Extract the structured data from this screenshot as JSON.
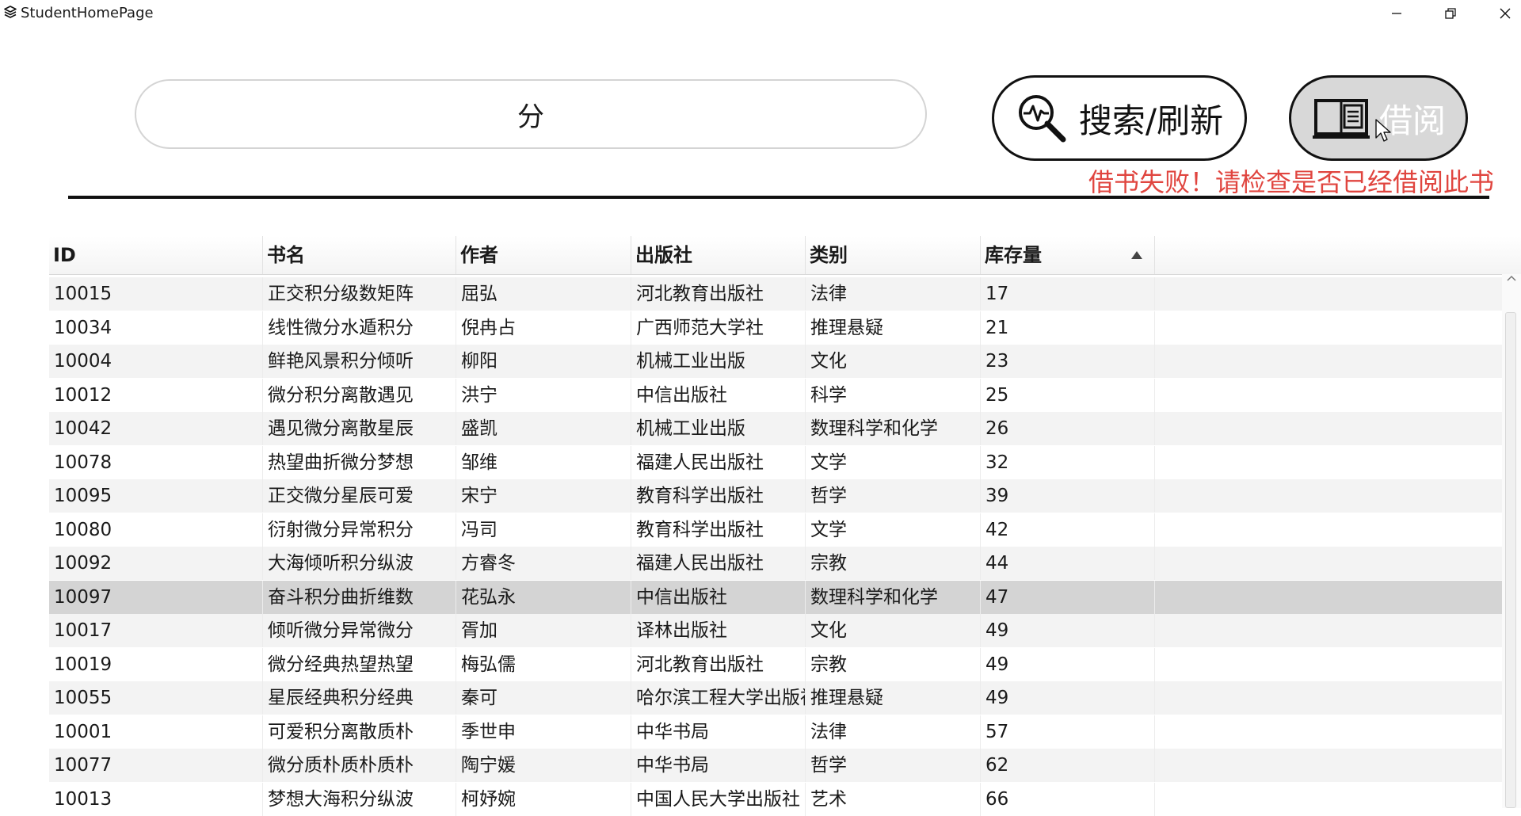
{
  "window": {
    "title": "StudentHomePage",
    "app_icon": "stack-icon"
  },
  "search": {
    "value": "分"
  },
  "buttons": {
    "search_label": "搜索/刷新",
    "borrow_label": "借阅"
  },
  "message": {
    "error": "借书失败！请检查是否已经借阅此书",
    "color": "#e0453f"
  },
  "table": {
    "columns": [
      "ID",
      "书名",
      "作者",
      "出版社",
      "类别",
      "库存量"
    ],
    "sorted_column": "库存量",
    "sort_direction": "ascending",
    "selected_row": 9,
    "rows": [
      [
        "10015",
        "正交积分级数矩阵",
        "屈弘",
        "河北教育出版社",
        "法律",
        "17"
      ],
      [
        "10034",
        "线性微分水遁积分",
        "倪冉占",
        "广西师范大学社",
        "推理悬疑",
        "21"
      ],
      [
        "10004",
        "鲜艳风景积分倾听",
        "柳阳",
        "机械工业出版",
        "文化",
        "23"
      ],
      [
        "10012",
        "微分积分离散遇见",
        "洪宁",
        "中信出版社",
        "科学",
        "25"
      ],
      [
        "10042",
        "遇见微分离散星辰",
        "盛凯",
        "机械工业出版",
        "数理科学和化学",
        "26"
      ],
      [
        "10078",
        "热望曲折微分梦想",
        "邹维",
        "福建人民出版社",
        "文学",
        "32"
      ],
      [
        "10095",
        "正交微分星辰可爱",
        "宋宁",
        "教育科学出版社",
        "哲学",
        "39"
      ],
      [
        "10080",
        "衍射微分异常积分",
        "冯司",
        "教育科学出版社",
        "文学",
        "42"
      ],
      [
        "10092",
        "大海倾听积分纵波",
        "方睿冬",
        "福建人民出版社",
        "宗教",
        "44"
      ],
      [
        "10097",
        "奋斗积分曲折维数",
        "花弘永",
        "中信出版社",
        "数理科学和化学",
        "47"
      ],
      [
        "10017",
        "倾听微分异常微分",
        "胥加",
        "译林出版社",
        "文化",
        "49"
      ],
      [
        "10019",
        "微分经典热望热望",
        "梅弘儒",
        "河北教育出版社",
        "宗教",
        "49"
      ],
      [
        "10055",
        "星辰经典积分经典",
        "秦可",
        "哈尔滨工程大学出版社",
        "推理悬疑",
        "49"
      ],
      [
        "10001",
        "可爱积分离散质朴",
        "季世申",
        "中华书局",
        "法律",
        "57"
      ],
      [
        "10077",
        "微分质朴质朴质朴",
        "陶宁媛",
        "中华书局",
        "哲学",
        "62"
      ],
      [
        "10013",
        "梦想大海积分纵波",
        "柯妤婉",
        "中国人民大学出版社",
        "艺术",
        "66"
      ]
    ]
  }
}
